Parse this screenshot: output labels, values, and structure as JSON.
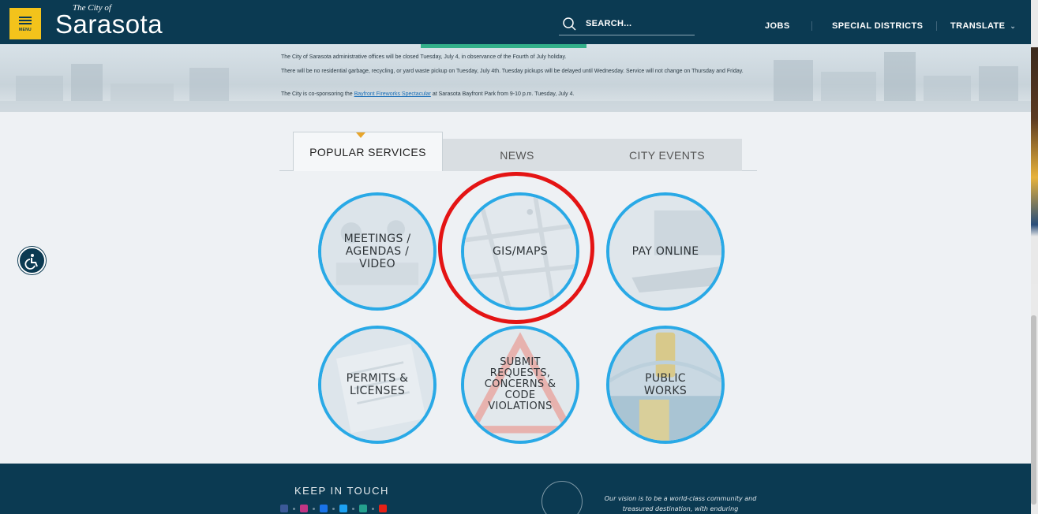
{
  "header": {
    "menu_label": "MENU",
    "logo_small": "The City of",
    "logo_big": "Sarasota",
    "search_label": "SEARCH...",
    "nav": [
      "JOBS",
      "SPECIAL DISTRICTS",
      "TRANSLATE"
    ],
    "colors": {
      "bar": "#0b3a52",
      "menu": "#f3c31b"
    }
  },
  "banner": {
    "notice_1": "The City of Sarasota administrative offices will be closed Tuesday, July 4, in observance of the Fourth of July holiday.",
    "notice_2": "There will be no residential garbage, recycling, or yard waste pickup on Tuesday, July 4th. Tuesday pickups will be delayed until Wednesday. Service will not change on Thursday and Friday.",
    "notice_3_pre": "The City is co-sponsoring the ",
    "notice_3_link": "Bayfront Fireworks Spectacular",
    "notice_3_post": " at Sarasota Bayfront Park from 9-10 p.m. Tuesday, July 4."
  },
  "tabs": [
    {
      "label": "POPULAR SERVICES",
      "active": true
    },
    {
      "label": "NEWS",
      "active": false
    },
    {
      "label": "CITY EVENTS",
      "active": false
    }
  ],
  "services": [
    {
      "label": "MEETINGS /\nAGENDAS /\nVIDEO",
      "icon": "meeting-icon"
    },
    {
      "label": "GIS/MAPS",
      "icon": "map-icon"
    },
    {
      "label": "PAY ONLINE",
      "icon": "laptop-icon"
    },
    {
      "label": "PERMITS &\nLICENSES",
      "icon": "document-icon"
    },
    {
      "label": "SUBMIT\nREQUESTS,\nCONCERNS &\nCODE\nVIOLATIONS",
      "icon": "warning-icon"
    },
    {
      "label": "PUBLIC\nWORKS",
      "icon": "traffic-light-icon"
    }
  ],
  "footer": {
    "keep_in_touch": "KEEP IN TOUCH",
    "vision": "Our vision is to be a world-class community and treasured destination, with enduring",
    "social_colors": [
      "#3b5998",
      "#c13584",
      "#1a73e8",
      "#1da1f2",
      "#25a18e",
      "#e62117"
    ]
  },
  "accent_color": "#29a9e6",
  "highlight_color": "#e41414"
}
